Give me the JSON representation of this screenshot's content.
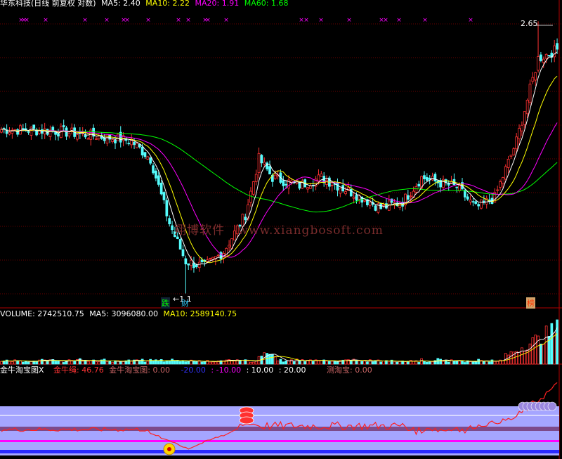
{
  "price_panel": {
    "stock_name": "华东科技(日线 前复权 对数)",
    "ma_labels": [
      {
        "text": "MA5: 2.40",
        "color": "#ffffff"
      },
      {
        "text": "MA10: 2.22",
        "color": "#ffff00"
      },
      {
        "text": "MA20: 1.91",
        "color": "#ff00ff"
      },
      {
        "text": "MA60: 1.68",
        "color": "#00ff00"
      }
    ],
    "high_label": "2.65",
    "low_label": "←1.1",
    "markers": [
      {
        "text": "跌",
        "color": "#00ff00"
      },
      {
        "text": "财",
        "color": "#33ccff"
      },
      {
        "text": "榜",
        "color": "#ff3300"
      }
    ],
    "top_mark": "×"
  },
  "volume_panel": {
    "labels": [
      {
        "text": "VOLUME: 2742510.75",
        "color": "#ffffff"
      },
      {
        "text": "MA5: 3096080.00",
        "color": "#ffffff"
      },
      {
        "text": "MA10: 2589140.75",
        "color": "#ffff00"
      }
    ]
  },
  "indicator_panel": {
    "labels": [
      {
        "text": "金牛淘宝图X",
        "color": "#ffffff"
      },
      {
        "text": "金牛绳: 46.76",
        "color": "#ff3333"
      },
      {
        "text": "金牛淘宝图: 0.00",
        "color": "#cc6666"
      },
      {
        "text": "-20.00",
        "color": "#3333ff"
      },
      {
        "text": ": -10.00",
        "color": "#ff00ff"
      },
      {
        "text": ": 10.00",
        "color": "#ffffff"
      },
      {
        "text": ": 20.00",
        "color": "#ffffff"
      },
      {
        "text": "测淘宝: 0.00",
        "color": "#cc6666"
      }
    ]
  },
  "watermark": [
    "翔博软件",
    "www.xiangbosoft.com"
  ],
  "colors": {
    "up": "#ff3232",
    "down": "#54fcfc",
    "ma5": "#ffffff",
    "ma10": "#ffff00",
    "ma20": "#ff00ff",
    "ma60": "#00ff00",
    "grid": "#8b0000"
  },
  "chart_data": {
    "type": "candlestick",
    "scale": "log",
    "ylim": [
      1.05,
      2.75
    ],
    "last_values": {
      "MA5": 2.4,
      "MA10": 2.22,
      "MA20": 1.91,
      "MA60": 1.68
    },
    "high": 2.65,
    "low": 1.1,
    "close_anchors": [
      [
        0,
        1.87
      ],
      [
        20,
        1.86
      ],
      [
        40,
        1.82
      ],
      [
        48,
        1.8
      ],
      [
        55,
        1.7
      ],
      [
        62,
        1.38
      ],
      [
        68,
        1.22
      ],
      [
        75,
        1.2
      ],
      [
        82,
        1.26
      ],
      [
        90,
        1.42
      ],
      [
        95,
        1.7
      ],
      [
        100,
        1.6
      ],
      [
        110,
        1.56
      ],
      [
        118,
        1.6
      ],
      [
        130,
        1.52
      ],
      [
        140,
        1.45
      ],
      [
        148,
        1.48
      ],
      [
        155,
        1.6
      ],
      [
        160,
        1.58
      ],
      [
        168,
        1.55
      ],
      [
        175,
        1.45
      ],
      [
        182,
        1.5
      ],
      [
        190,
        1.8
      ],
      [
        198,
        2.35
      ],
      [
        205,
        2.42
      ]
    ],
    "volume": {
      "last": 2742510.75,
      "ma5": 3096080.0,
      "ma10": 2589140.75
    },
    "indicator": {
      "jin_niu_sheng": 46.76,
      "levels": [
        -20,
        -10,
        10,
        20
      ],
      "jin_niu_tao_bao": 0,
      "ce_tao_bao": 0
    }
  }
}
